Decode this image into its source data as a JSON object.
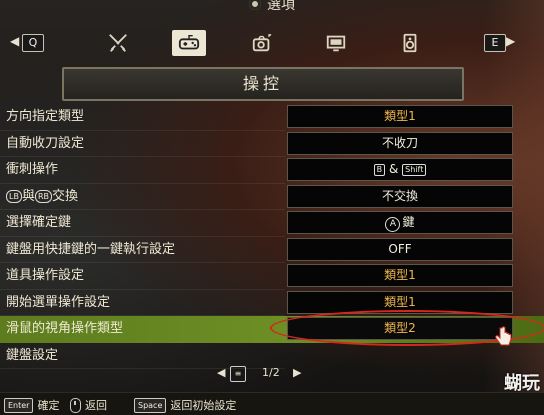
{
  "window": {
    "title": "選項"
  },
  "tabs": {
    "prev_key": "Q",
    "next_key": "E",
    "items": [
      {
        "icon": "swords-icon"
      },
      {
        "icon": "gamepad-icon",
        "active": true
      },
      {
        "icon": "camera-icon"
      },
      {
        "icon": "monitor-icon"
      },
      {
        "icon": "speaker-icon"
      }
    ]
  },
  "section": {
    "title": "操控"
  },
  "settings": [
    {
      "label": "方向指定類型",
      "value": "類型1",
      "value_style": "amber"
    },
    {
      "label": "自動收刀設定",
      "value": "不收刀"
    },
    {
      "label": "衝刺操作",
      "value_btn1": "B",
      "value_amp": "&",
      "value_btn2": "Shift"
    },
    {
      "label_btn1": "LB",
      "label_mid": "與",
      "label_btn2": "RB",
      "label_tail": "交換",
      "value": "不交換"
    },
    {
      "label": "選擇確定鍵",
      "value_circle": "A",
      "value_tail": "鍵"
    },
    {
      "label": "鍵盤用快捷鍵的一鍵執行設定",
      "value": "OFF"
    },
    {
      "label": "道具操作設定",
      "value": "類型1",
      "value_style": "amber"
    },
    {
      "label": "開始選單操作設定",
      "value": "類型1",
      "value_style": "amber"
    },
    {
      "label": "滑鼠的視角操作類型",
      "value": "類型2",
      "value_style": "amber",
      "highlighted": true
    },
    {
      "label": "鍵盤設定"
    }
  ],
  "pager": {
    "text": "1/2"
  },
  "bottom_bar": {
    "confirm": {
      "key": "Enter",
      "label": "確定"
    },
    "back": {
      "label": "返回"
    },
    "reset": {
      "key": "Space",
      "label": "返回初始設定"
    }
  },
  "watermark": {
    "text": "蝴玩",
    "sub": ""
  },
  "colors": {
    "highlight": "#6e8f25",
    "amber": "#f0b64a",
    "annotation": "#d5281c"
  }
}
